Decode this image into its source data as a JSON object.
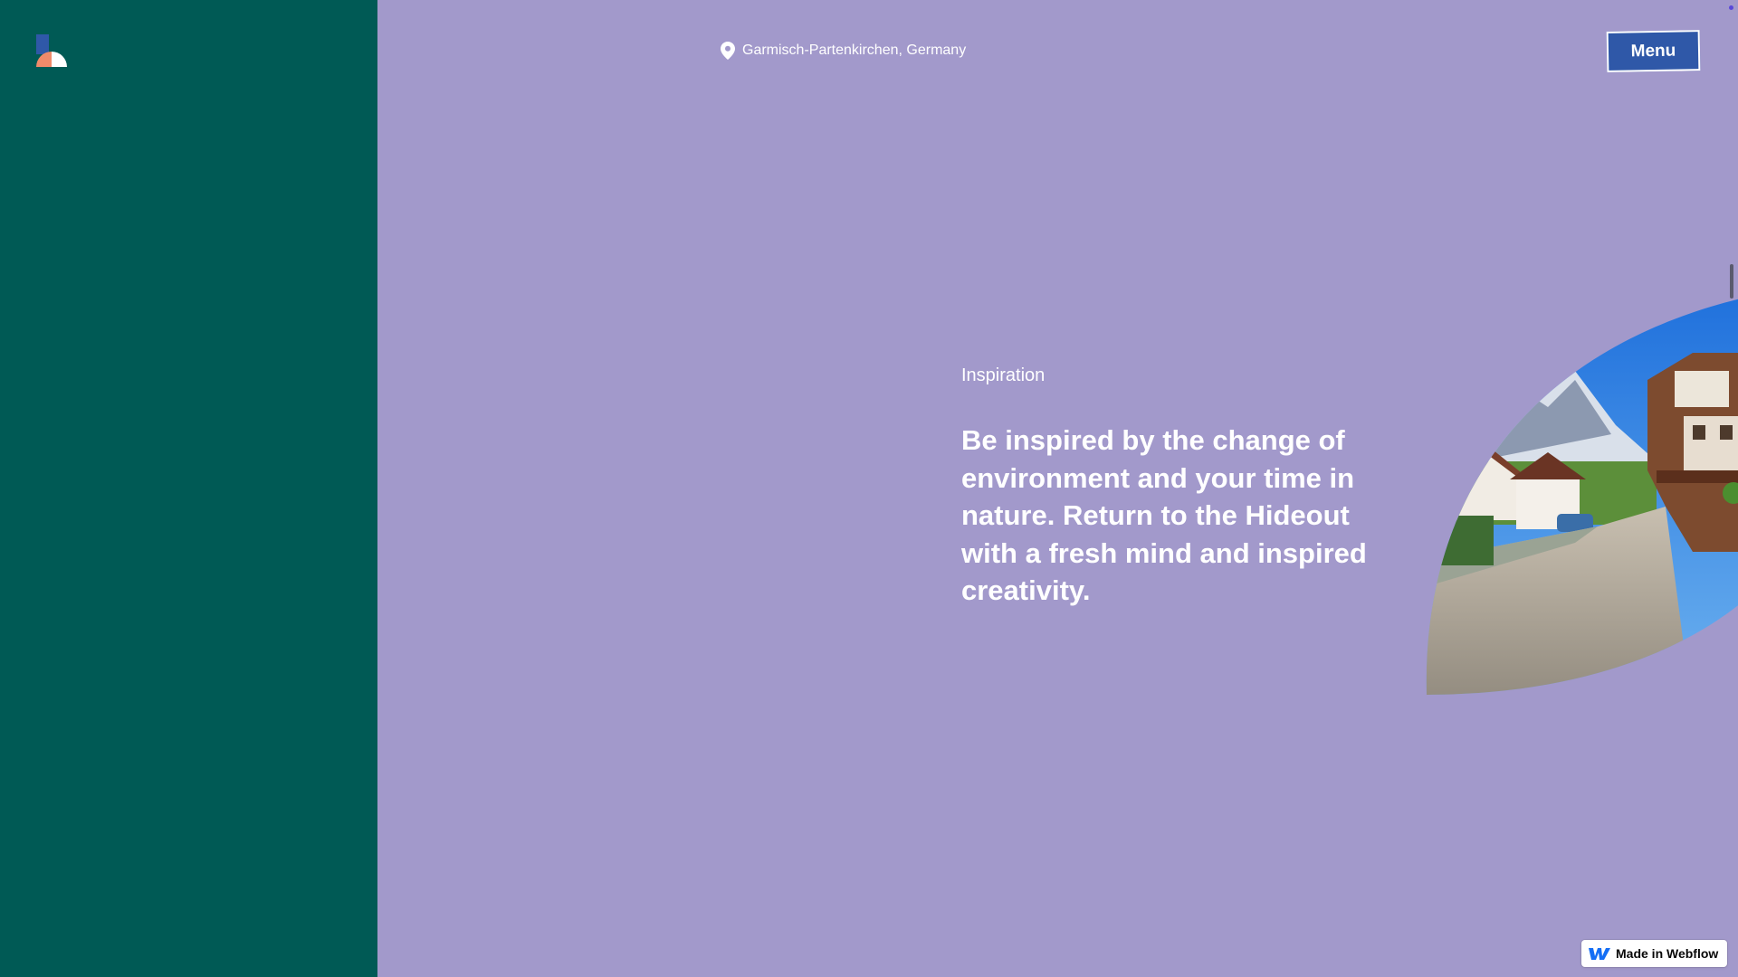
{
  "header": {
    "logo_icon": "hideout-logo-icon",
    "location_icon": "map-pin-icon",
    "location_text": "Garmisch-Partenkirchen, Germany",
    "menu_label": "Menu"
  },
  "hero": {
    "eyebrow": "Inspiration",
    "headline": "Be inspired by the change of environment and your time in nature. Return to the Hideout with a fresh mind and inspired creativity.",
    "image_icon": "alpine-village-street-image"
  },
  "badge": {
    "icon": "webflow-logo-icon",
    "label": "Made in Webflow"
  },
  "colors": {
    "background": "#a299cb",
    "sidebar": "#005a55",
    "menu_button": "#2f58a8",
    "text": "#ffffff"
  }
}
